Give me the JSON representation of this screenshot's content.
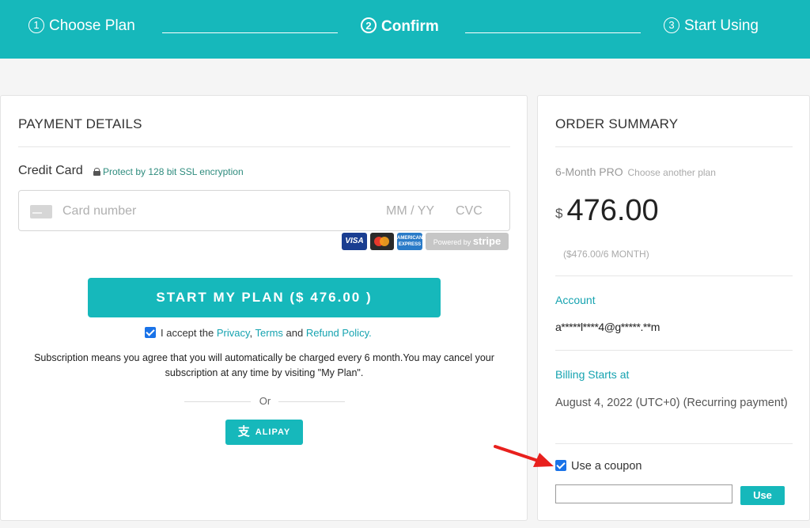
{
  "steps": [
    {
      "num": "1",
      "label": "Choose Plan"
    },
    {
      "num": "2",
      "label": "Confirm"
    },
    {
      "num": "3",
      "label": "Start Using"
    }
  ],
  "payment": {
    "title": "PAYMENT DETAILS",
    "credit_card_label": "Credit Card",
    "ssl_text": "Protect by 128 bit SSL encryption",
    "card_number_placeholder": "Card number",
    "expiry_placeholder": "MM / YY",
    "cvc_placeholder": "CVC",
    "brands": {
      "visa": "VISA",
      "amex": "AMERICAN EXPRESS",
      "stripe_prefix": "Powered by",
      "stripe_name": "stripe"
    },
    "start_button": "START MY PLAN ($ 476.00 )",
    "accept": {
      "checked": true,
      "prefix": "I accept the",
      "privacy": "Privacy",
      "comma": ",",
      "terms": "Terms",
      "and": "and",
      "refund": "Refund Policy",
      "period": "."
    },
    "subscription_note": "Subscription means you agree that you will automatically be charged every 6 month.You may cancel your subscription at any time by visiting \"My Plan\".",
    "or_text": "Or",
    "alipay_glyph": "支",
    "alipay_label": "ALIPAY"
  },
  "order": {
    "title": "ORDER SUMMARY",
    "plan_name": "6-Month PRO",
    "choose_another": "Choose another plan",
    "currency": "$",
    "amount": "476.00",
    "per_period": "($476.00/6 MONTH)",
    "account_label": "Account",
    "account_value": "a*****l****4@g*****.**m",
    "billing_label": "Billing Starts at",
    "billing_value": "August 4, 2022 (UTC+0) (Recurring payment)",
    "coupon_label": "Use a coupon",
    "coupon_checked": true,
    "coupon_value": "",
    "use_button": "Use"
  },
  "colors": {
    "accent": "#16b8bb",
    "link": "#16a3b0",
    "annotation_arrow": "#e8201d"
  }
}
